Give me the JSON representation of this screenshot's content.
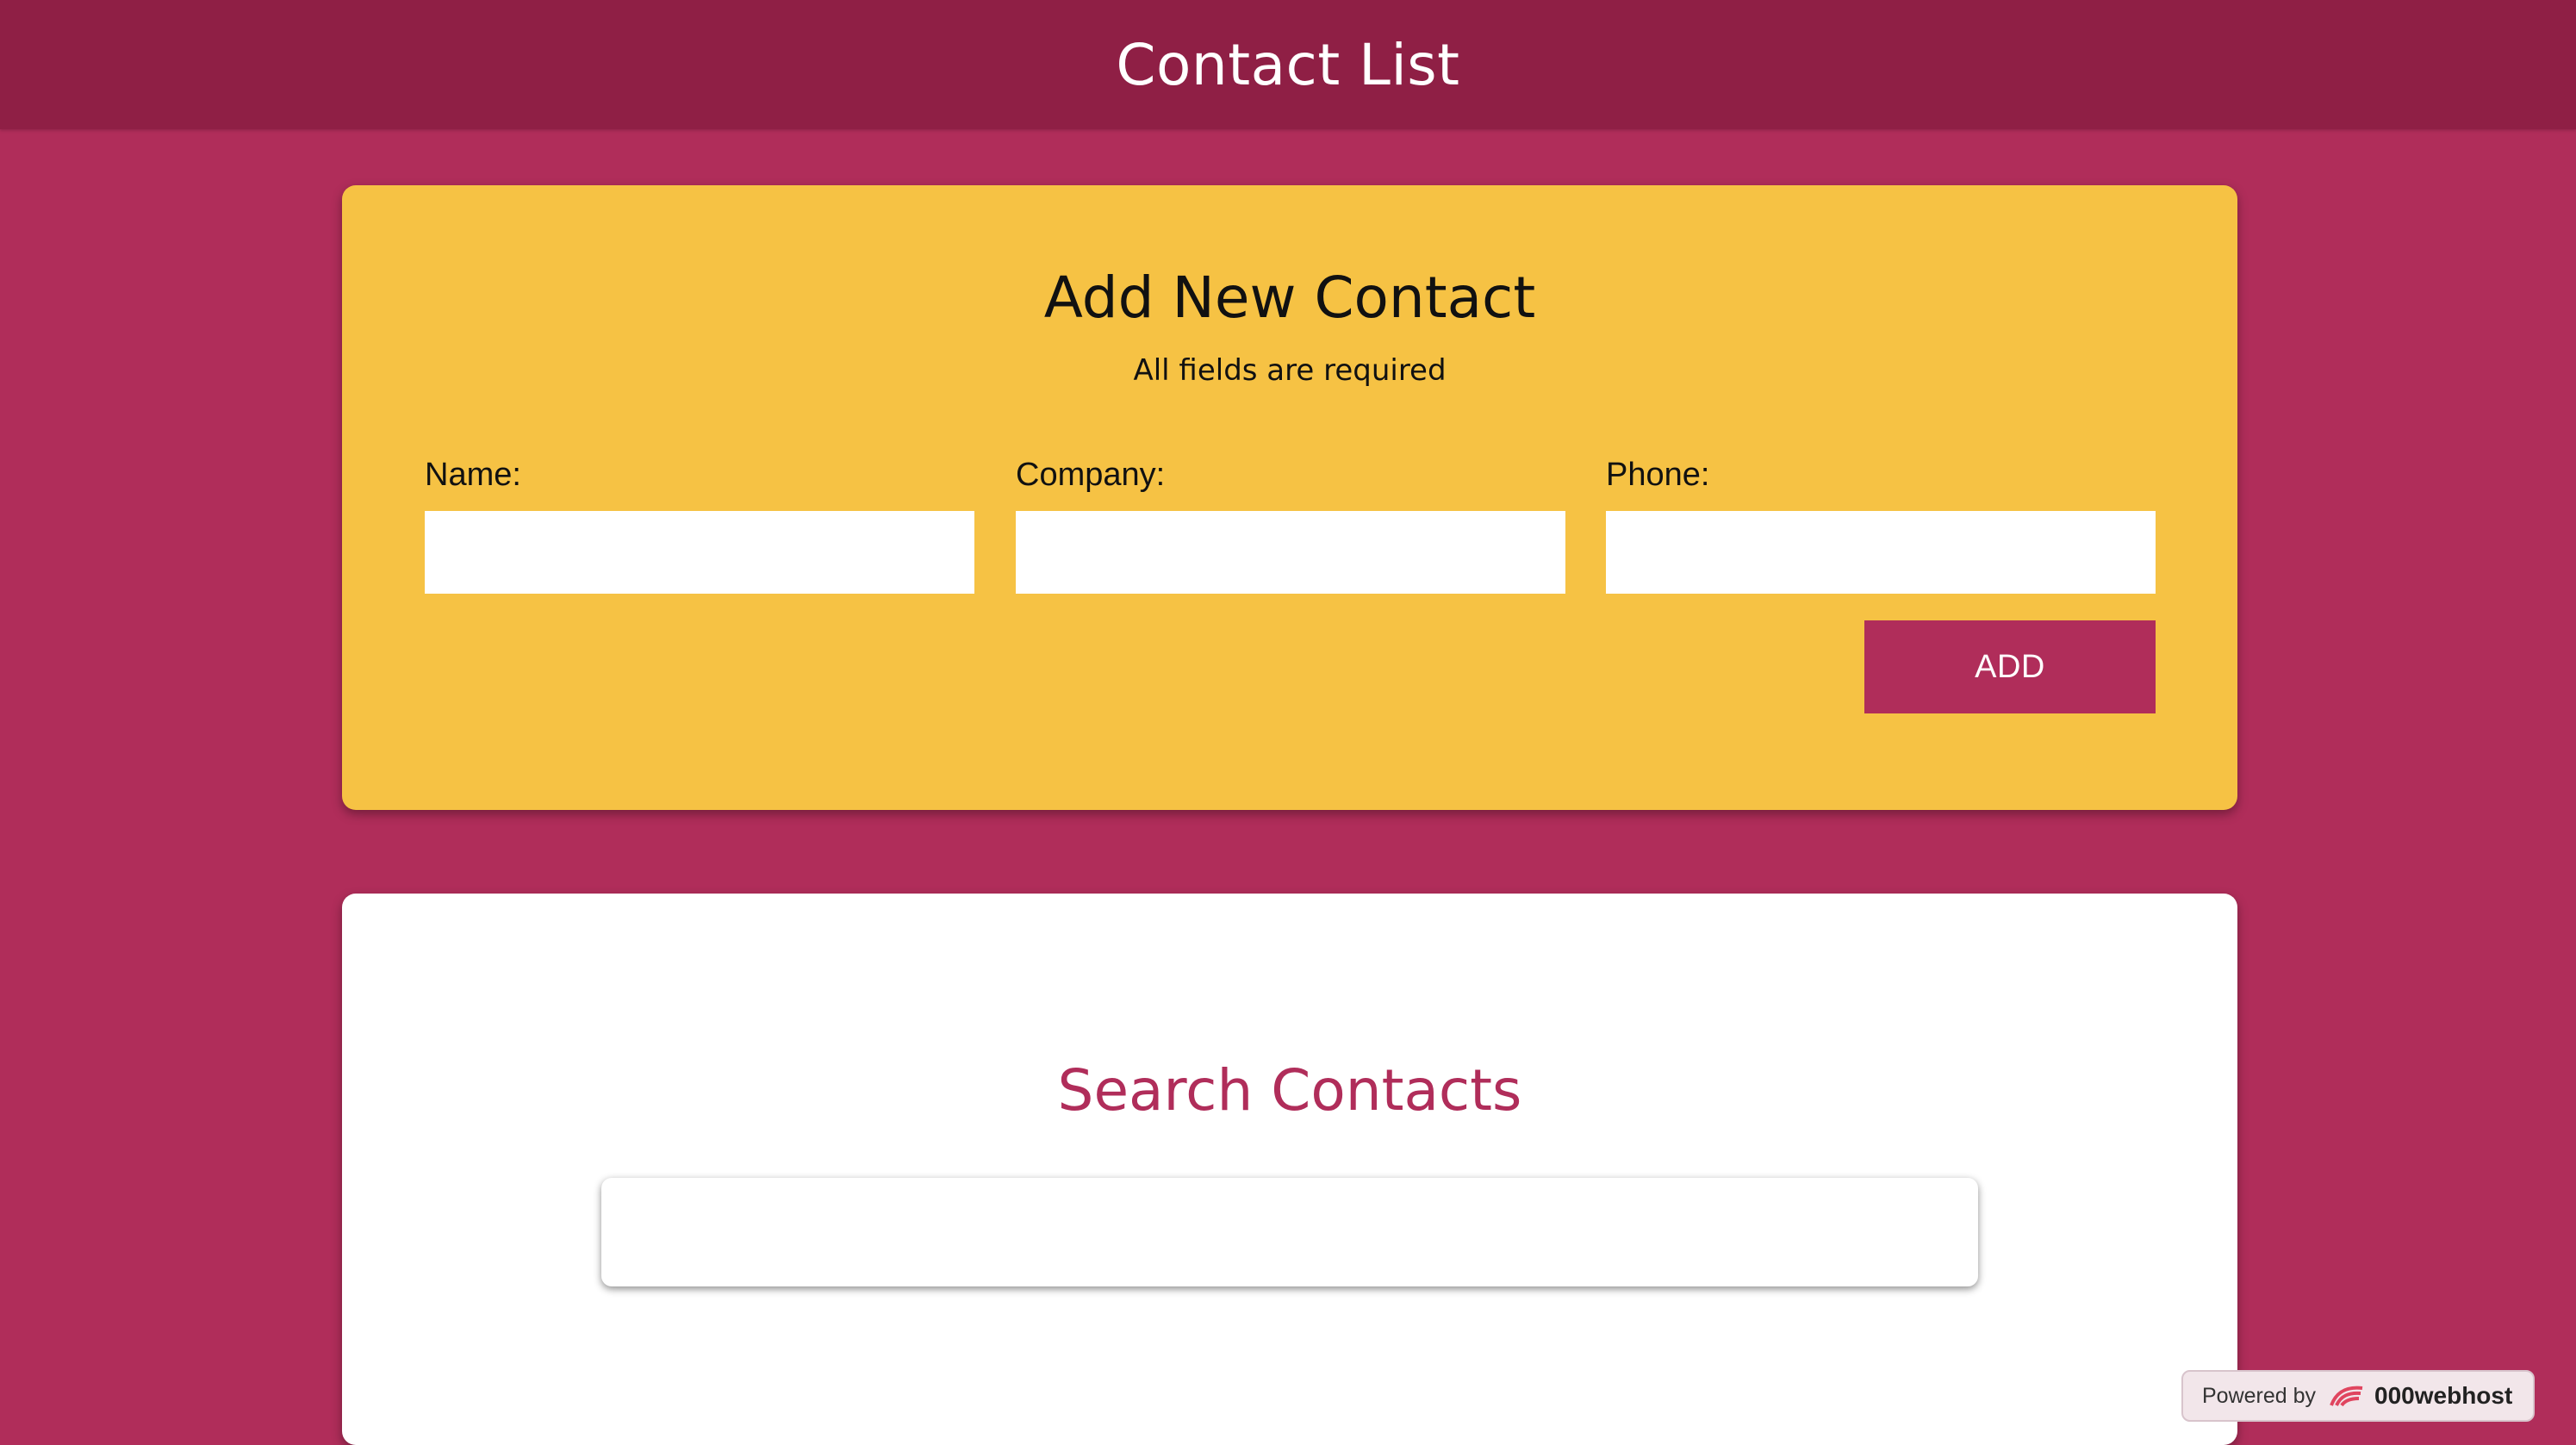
{
  "header": {
    "title": "Contact List"
  },
  "add_contact": {
    "title": "Add New Contact",
    "subtitle": "All fields are required",
    "fields": [
      {
        "label": "Name:",
        "value": "",
        "placeholder": ""
      },
      {
        "label": "Company:",
        "value": "",
        "placeholder": ""
      },
      {
        "label": "Phone:",
        "value": "",
        "placeholder": ""
      }
    ],
    "add_button_label": "ADD"
  },
  "search": {
    "title": "Search Contacts",
    "value": "",
    "placeholder": ""
  },
  "footer_badge": {
    "prefix": "Powered by",
    "brand": "000webhost",
    "icon": "webhost-logo-icon"
  },
  "colors": {
    "background": "#b02d5a",
    "header": "#8f1f45",
    "card_accent": "#f6c244",
    "button": "#b02d5a",
    "search_title": "#b02d5a"
  }
}
